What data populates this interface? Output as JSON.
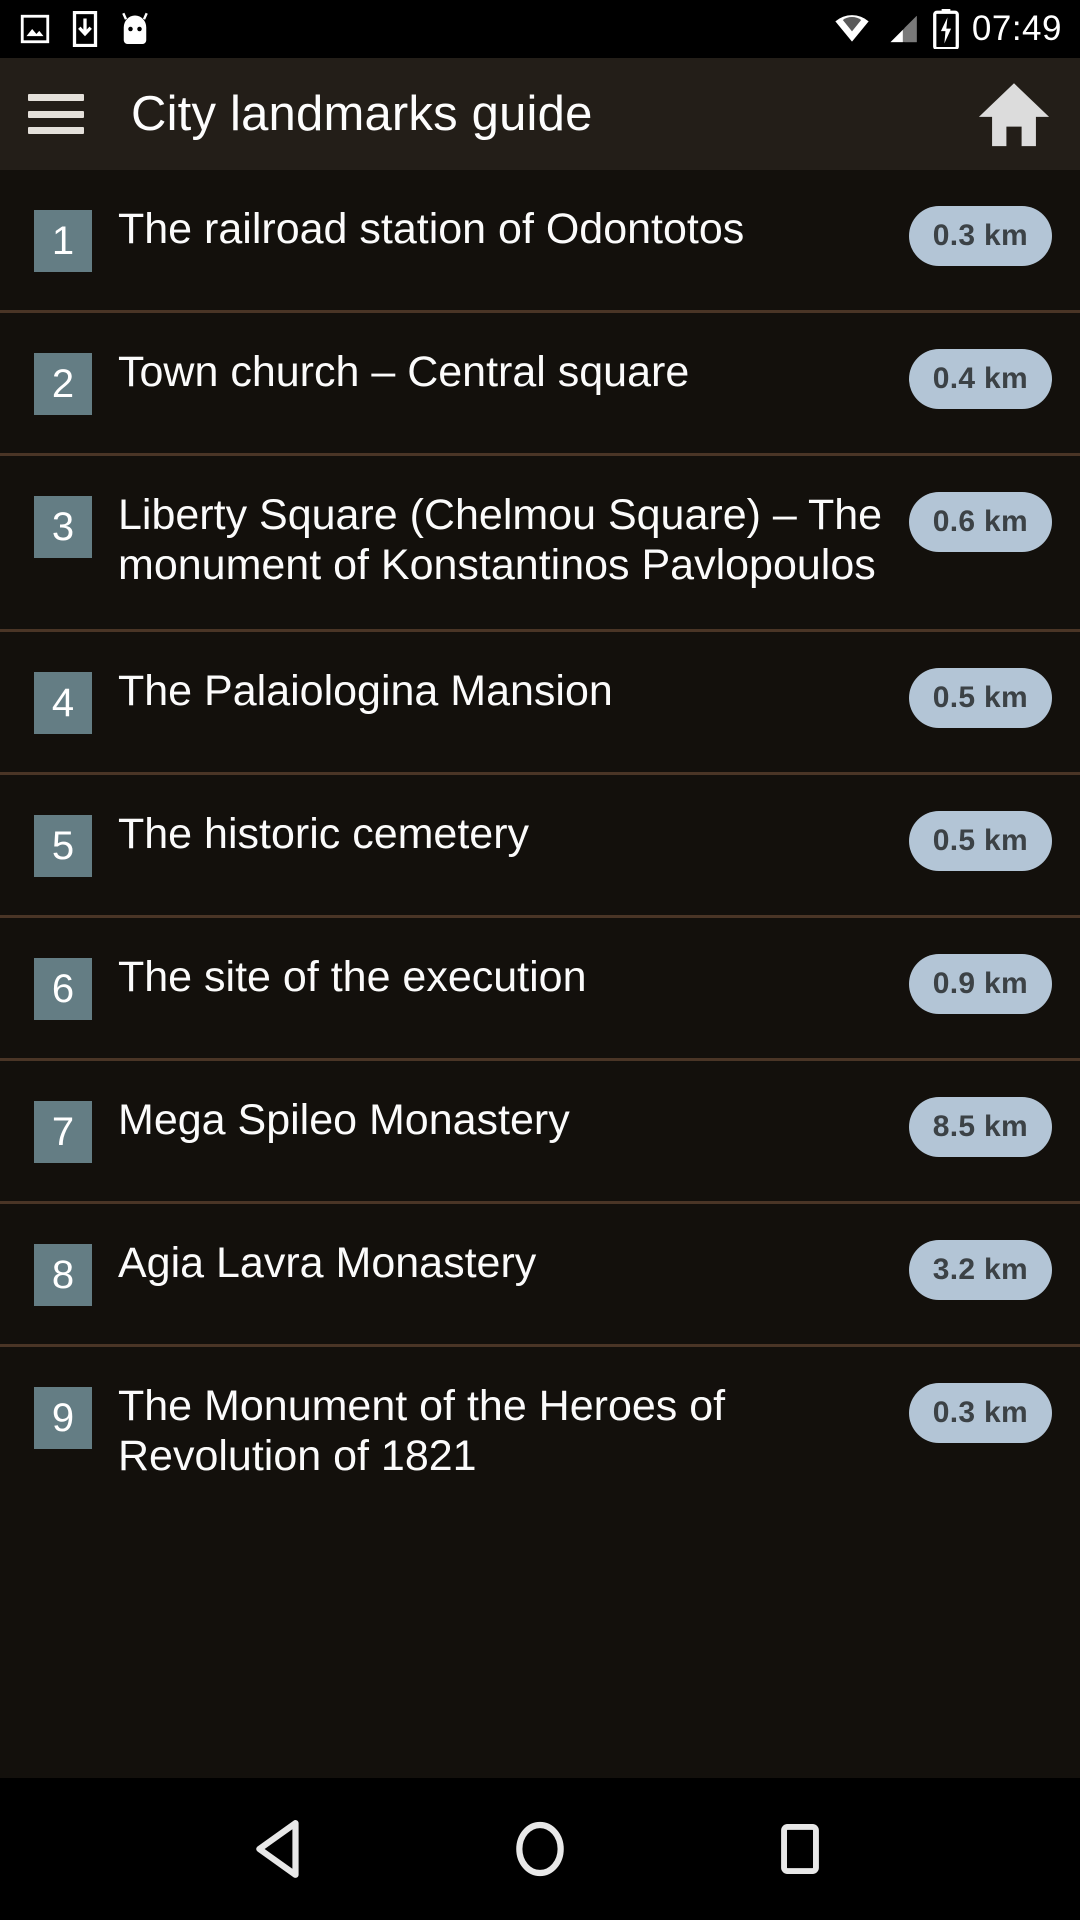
{
  "status_bar": {
    "icons": [
      "image-icon",
      "download-icon",
      "android-icon"
    ],
    "right_icons": [
      "wifi-icon",
      "signal-icon",
      "battery-charging-icon"
    ],
    "clock": "07:49"
  },
  "app_bar": {
    "menu_icon": "hamburger-menu-icon",
    "title": "City landmarks guide",
    "home_icon": "home-icon"
  },
  "list": {
    "items": [
      {
        "number": "1",
        "title": "The railroad station of Odontotos",
        "distance": "0.3 km"
      },
      {
        "number": "2",
        "title": "Town church – Central square",
        "distance": "0.4 km"
      },
      {
        "number": "3",
        "title": "Liberty Square (Chelmou Square) – The monument of Konstantinos Pavlopoulos",
        "distance": "0.6 km"
      },
      {
        "number": "4",
        "title": "The Palaiologina Mansion",
        "distance": "0.5 km"
      },
      {
        "number": "5",
        "title": "The historic cemetery",
        "distance": "0.5 km"
      },
      {
        "number": "6",
        "title": "The site of the execution",
        "distance": "0.9 km"
      },
      {
        "number": "7",
        "title": "Mega Spileo Monastery",
        "distance": "8.5 km"
      },
      {
        "number": "8",
        "title": "Agia Lavra Monastery",
        "distance": "3.2 km"
      },
      {
        "number": "9",
        "title": "The Monument of the Heroes of Revolution of 1821",
        "distance": "0.3 km"
      }
    ]
  },
  "nav_bar": {
    "back_icon": "back-triangle-icon",
    "home_icon": "home-circle-icon",
    "recents_icon": "recents-square-icon"
  },
  "colors": {
    "app_bar_bg": "#231e18",
    "list_bg": "#13100c",
    "divider": "#4a3526",
    "number_badge_bg": "#647d84",
    "distance_pill_bg": "#b3c5d6",
    "distance_pill_text": "#3c4246",
    "title_text": "#fbfbfb"
  }
}
